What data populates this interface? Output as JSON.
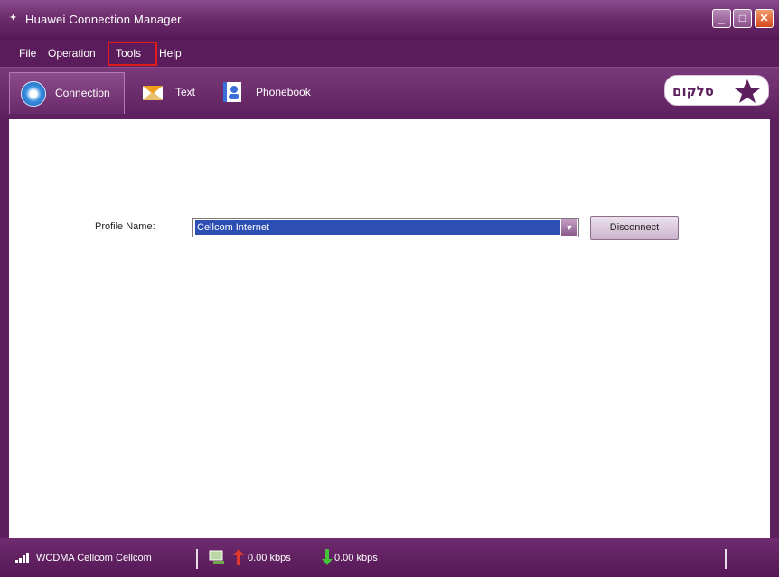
{
  "window": {
    "title": "Huawei Connection Manager"
  },
  "menu": {
    "items": [
      "File",
      "Operation",
      "Tools",
      "Help"
    ],
    "highlighted": "Tools"
  },
  "toolbar": {
    "tabs": [
      {
        "label": "Connection",
        "icon": "connection-icon"
      },
      {
        "label": "Text",
        "icon": "envelope-icon"
      },
      {
        "label": "Phonebook",
        "icon": "phonebook-icon"
      }
    ],
    "logo_text": "סלקום"
  },
  "main": {
    "profile_label": "Profile Name:",
    "profile_value": "Cellcom Internet",
    "disconnect_label": "Disconnect"
  },
  "status": {
    "network": "WCDMA Cellcom Cellcom",
    "upload": "0.00 kbps",
    "download": "0.00 kbps"
  },
  "colors": {
    "theme": "#5e1f5e",
    "highlight": "#e11a1a",
    "selection": "#2d4fb4"
  }
}
